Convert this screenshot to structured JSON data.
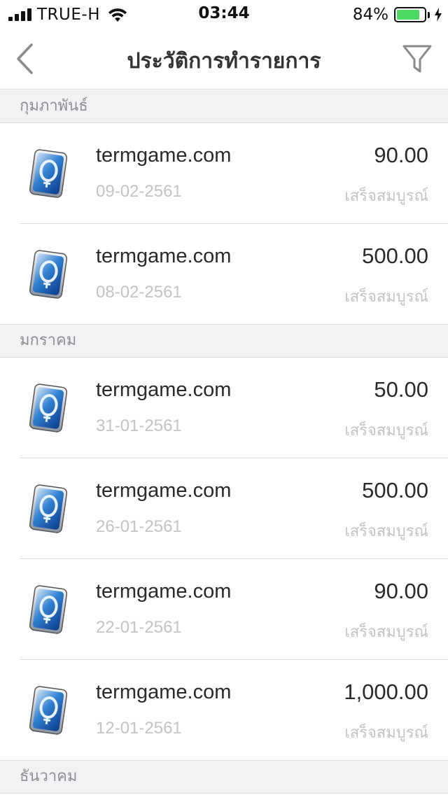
{
  "status_bar": {
    "carrier": "TRUE-H",
    "time": "03:44",
    "battery_percent": "84%",
    "battery_level": 0.84,
    "battery_color": "#4cd964"
  },
  "nav": {
    "title": "ประวัติการทำรายการ",
    "back_icon": "chevron-left-icon",
    "filter_icon": "filter-icon"
  },
  "sections": [
    {
      "month": "กุมภาพันธ์",
      "items": [
        {
          "merchant": "termgame.com",
          "date": "09-02-2561",
          "amount": "90.00",
          "status": "เสร็จสมบูรณ์"
        },
        {
          "merchant": "termgame.com",
          "date": "08-02-2561",
          "amount": "500.00",
          "status": "เสร็จสมบูรณ์"
        }
      ]
    },
    {
      "month": "มกราคม",
      "items": [
        {
          "merchant": "termgame.com",
          "date": "31-01-2561",
          "amount": "50.00",
          "status": "เสร็จสมบูรณ์"
        },
        {
          "merchant": "termgame.com",
          "date": "26-01-2561",
          "amount": "500.00",
          "status": "เสร็จสมบูรณ์"
        },
        {
          "merchant": "termgame.com",
          "date": "22-01-2561",
          "amount": "90.00",
          "status": "เสร็จสมบูรณ์"
        },
        {
          "merchant": "termgame.com",
          "date": "12-01-2561",
          "amount": "1,000.00",
          "status": "เสร็จสมบูรณ์"
        }
      ]
    },
    {
      "month": "ธันวาคม",
      "items": []
    }
  ]
}
